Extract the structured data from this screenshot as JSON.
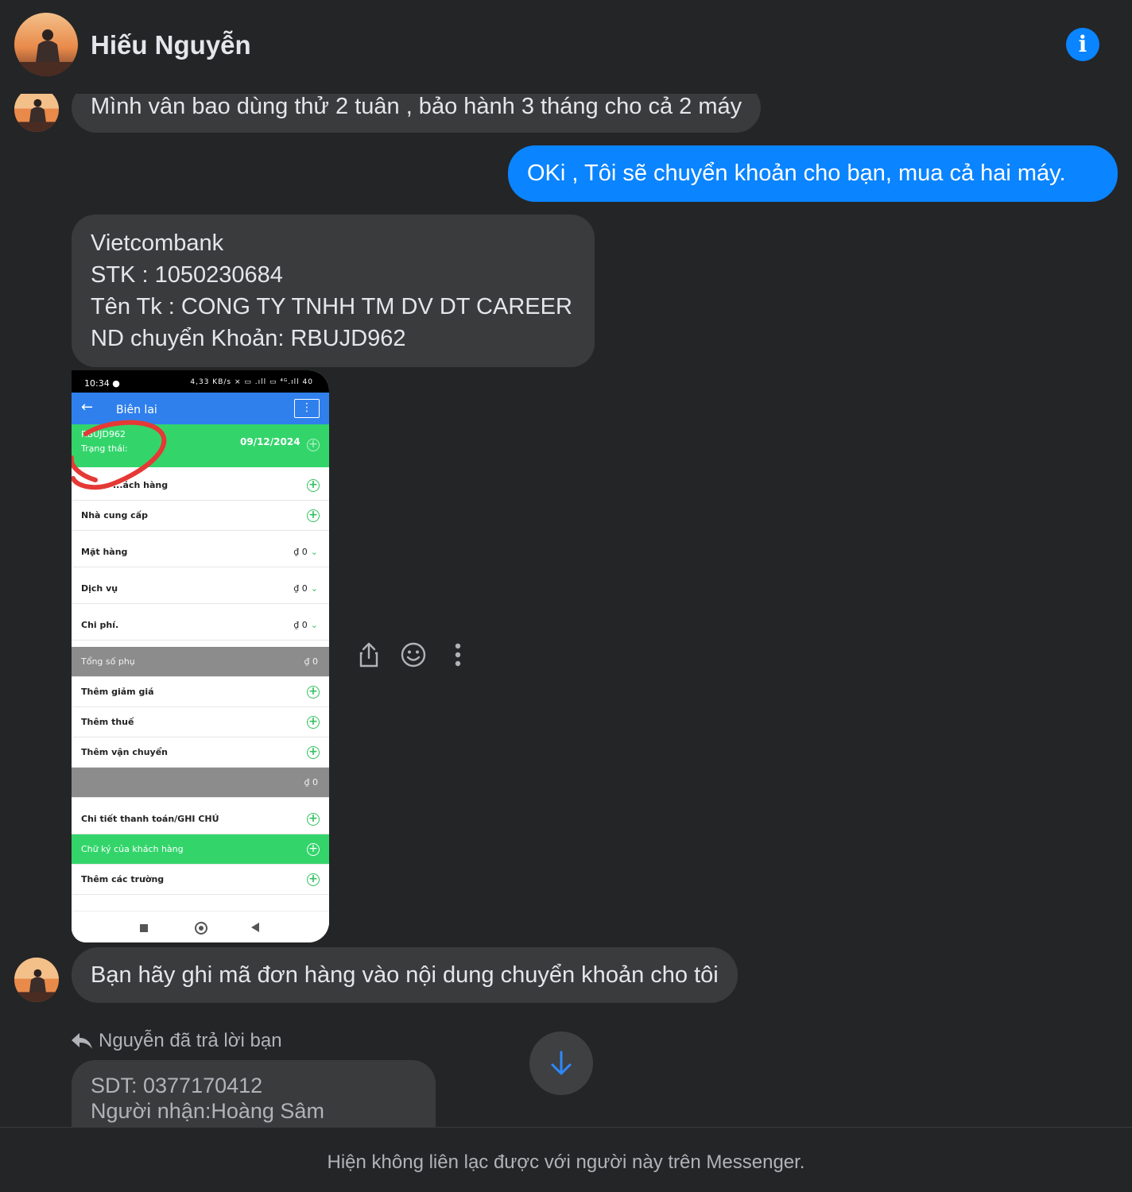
{
  "header": {
    "contact_name": "Hiếu Nguyễn",
    "info_icon": "info-icon",
    "info_label": "i"
  },
  "messages": {
    "m1": "Mình vân bao dùng thử 2 tuân , bảo hành 3 tháng cho cả 2 máy",
    "m2": "OKi ,   Tôi sẽ chuyển khoản cho bạn, mua cả hai máy.",
    "m3_lines": [
      "Vietcombank",
      "STK : 1050230684",
      "Tên Tk : CONG TY TNHH TM DV DT CAREER",
      "ND chuyển Khoản: RBUJD962"
    ],
    "m4": "Bạn hãy ghi mã đơn hàng vào nội dung chuyển khoản cho tôi"
  },
  "receipt_screenshot": {
    "time": "10:34",
    "status_icons": "4,33 KB/s ⨯ ▭ .ıll ▭ ⁴ᴳ.ıll 40",
    "title": "Biên lai",
    "order_id": "RBUJD962",
    "status_label": "Trạng thái:",
    "date": "09/12/2024",
    "rows": [
      {
        "label": "...ách hàng"
      },
      {
        "label": "Nhà cung cấp"
      },
      {
        "label": "Mặt hàng",
        "amount": "₫ 0"
      },
      {
        "label": "Dịch vụ",
        "amount": "₫ 0"
      },
      {
        "label": "Chi phí.",
        "amount": "₫ 0"
      },
      {
        "label": "Tổng số phụ",
        "amount": "₫ 0"
      },
      {
        "label": "Thêm giảm giá"
      },
      {
        "label": "Thêm thuế"
      },
      {
        "label": "Thêm vận chuyển"
      },
      {
        "label": "",
        "amount": "₫ 0"
      },
      {
        "label": "Chi tiết thanh toán/GHI CHÚ"
      },
      {
        "label": "Chữ ký của khách hàng"
      },
      {
        "label": "Thêm các trường"
      }
    ]
  },
  "reply": {
    "note": "Nguyễn đã trả lời bạn",
    "lines": [
      "SDT: 0377170412",
      "Người nhận:Hoàng Sâm"
    ]
  },
  "footer": {
    "notice": "Hiện không liên lạc được với người này trên Messenger."
  },
  "colors": {
    "background": "#242526",
    "incoming_bubble": "#3a3b3c",
    "outgoing_bubble": "#0a84ff",
    "receipt_green": "#33d56b",
    "receipt_blue": "#2f80ed"
  }
}
